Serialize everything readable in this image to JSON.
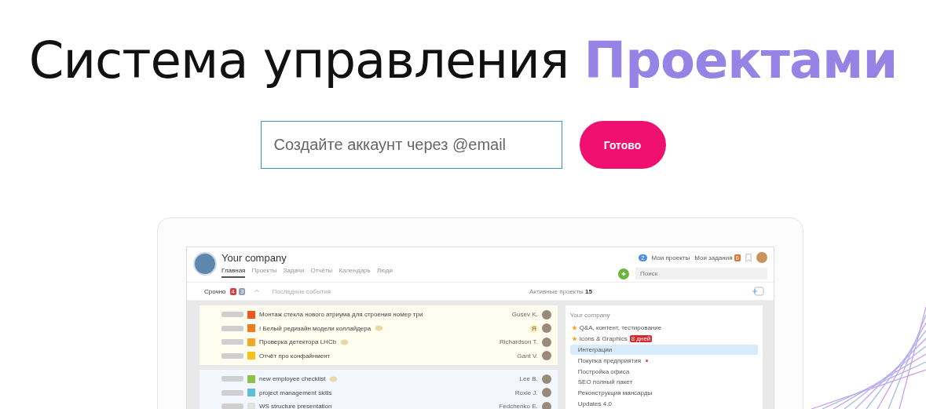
{
  "headline": {
    "text": "Система управления",
    "highlight": "Проектами"
  },
  "signup": {
    "placeholder": "Создайте аккаунт через @email",
    "button": "Готово"
  },
  "app": {
    "company": "Your company",
    "tabs": [
      {
        "label": "Главная",
        "selected": true
      },
      {
        "label": "Проекты",
        "selected": false
      },
      {
        "label": "Задачи",
        "selected": false
      },
      {
        "label": "Отчёты",
        "selected": false
      },
      {
        "label": "Календарь",
        "selected": false
      },
      {
        "label": "Люди",
        "selected": false
      }
    ],
    "notifications": "2",
    "links": [
      {
        "label": "Мои проекты"
      },
      {
        "label": "Мои задания",
        "badge": "6"
      }
    ],
    "search": {
      "placeholder": "Поиск"
    },
    "urgent": {
      "label": "Срочно",
      "counts": [
        {
          "value": "4",
          "color": "#e0393e"
        },
        {
          "value": "3",
          "color": "#8fa3b8"
        }
      ]
    },
    "recent": "Последние события",
    "active": {
      "label": "Активные проекты",
      "count": "15"
    },
    "task_groups": [
      {
        "kind": "urgent",
        "tasks": [
          {
            "color": "#f0561d",
            "title": "Монтаж стекла нового атриума для строения номер три",
            "comment": false,
            "assignee": "Gusev K.",
            "me": false
          },
          {
            "color": "#f07a1d",
            "title": "! Белый редизайн модели коллайдера",
            "comment": true,
            "assignee": "Я",
            "me": true
          },
          {
            "color": "#f5a623",
            "title": "Проверка детектора LHCb",
            "comment": true,
            "assignee": "Richardson T.",
            "me": false
          },
          {
            "color": "#f8c21c",
            "title": "Отчёт про конфайнмент",
            "comment": false,
            "assignee": "Gant V.",
            "me": false
          }
        ]
      },
      {
        "kind": "normal",
        "tasks": [
          {
            "color": "#8bc34a",
            "title": "new employee checklist",
            "comment": true,
            "assignee": "Lee B.",
            "me": false
          },
          {
            "color": "#5bc0de",
            "title": "project management skills",
            "comment": false,
            "assignee": "Roxie J.",
            "me": false
          },
          {
            "color": "#e0e0e0",
            "title": "WS structure presentation",
            "comment": false,
            "assignee": "Fedchenko E.",
            "me": false
          }
        ]
      }
    ],
    "projects": {
      "heading": "Your company",
      "items": [
        {
          "name": "Q&A, контент, тестирование",
          "starred": true,
          "selected": false
        },
        {
          "name": "Icons & Graphics",
          "starred": true,
          "selected": false,
          "badge": "8 дней"
        },
        {
          "name": "Интеграции",
          "starred": false,
          "selected": true
        },
        {
          "name": "Покупка предприятия",
          "starred": false,
          "selected": false,
          "flag": true
        },
        {
          "name": "Постройка офиса",
          "starred": false,
          "selected": false
        },
        {
          "name": "SEO полный пакет",
          "starred": false,
          "selected": false
        },
        {
          "name": "Реконструкция мансарды",
          "starred": false,
          "selected": false
        },
        {
          "name": "Updates 4.0",
          "starred": false,
          "selected": false
        }
      ]
    }
  }
}
